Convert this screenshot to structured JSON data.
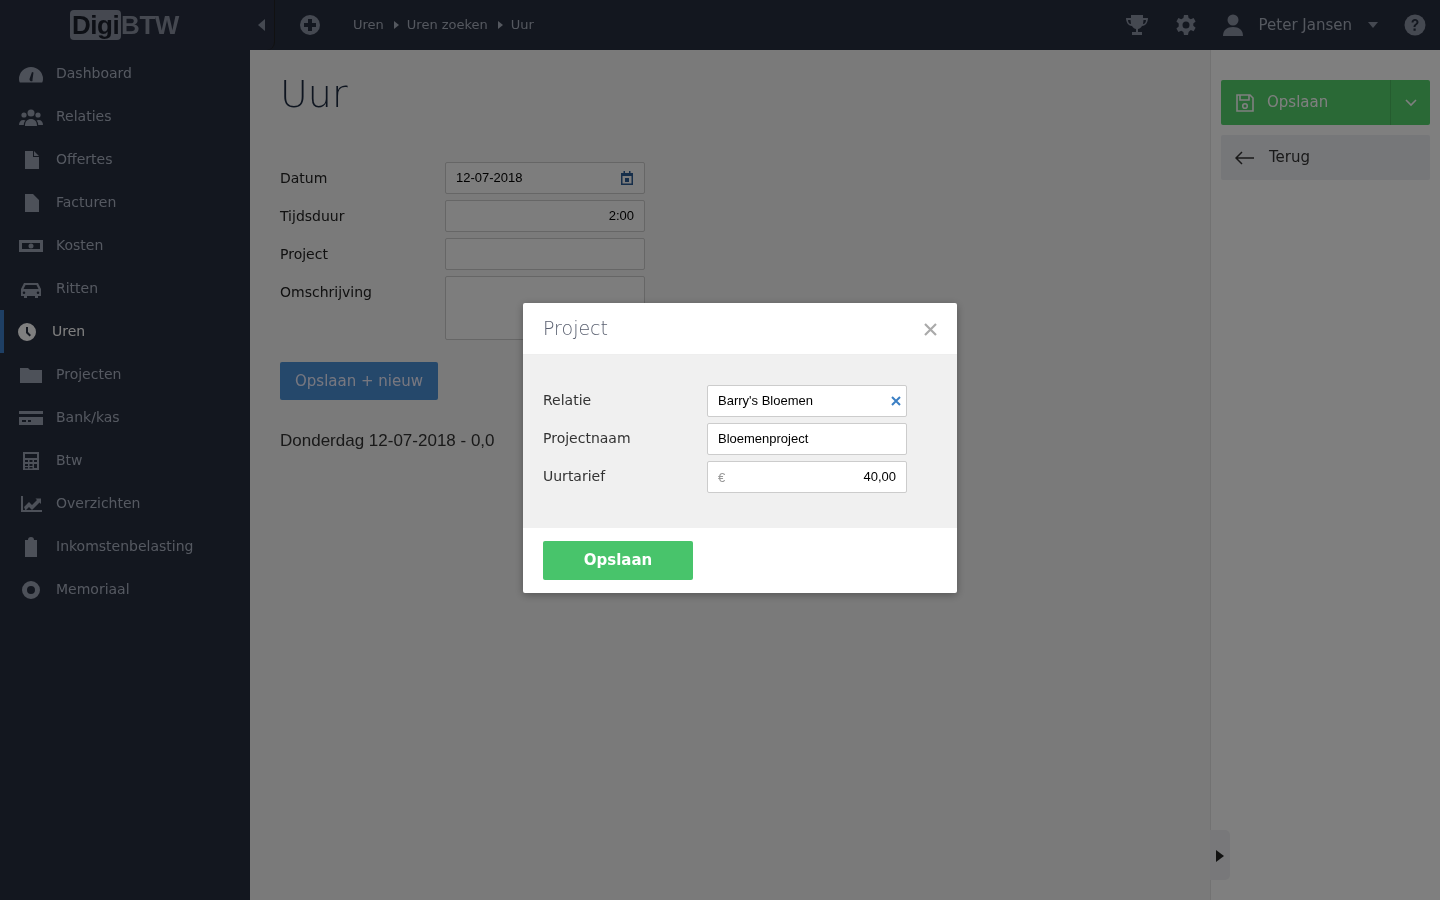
{
  "logo": {
    "boxed": "Digi",
    "plain": "BTW"
  },
  "breadcrumbs": [
    "Uren",
    "Uren zoeken",
    "Uur"
  ],
  "user": {
    "name": "Peter Jansen"
  },
  "sidebar": {
    "items": [
      {
        "label": "Dashboard",
        "selected": false
      },
      {
        "label": "Relaties",
        "selected": false
      },
      {
        "label": "Offertes",
        "selected": false
      },
      {
        "label": "Facturen",
        "selected": false
      },
      {
        "label": "Kosten",
        "selected": false
      },
      {
        "label": "Ritten",
        "selected": false
      },
      {
        "label": "Uren",
        "selected": true
      },
      {
        "label": "Projecten",
        "selected": false
      },
      {
        "label": "Bank/kas",
        "selected": false
      },
      {
        "label": "Btw",
        "selected": false
      },
      {
        "label": "Overzichten",
        "selected": false
      },
      {
        "label": "Inkomstenbelasting",
        "selected": false
      },
      {
        "label": "Memoriaal",
        "selected": false
      }
    ]
  },
  "page": {
    "title": "Uur",
    "fields": [
      {
        "label": "Datum",
        "kind": "date",
        "value": "12-07-2018"
      },
      {
        "label": "Tijdsduur",
        "kind": "number",
        "value": "2:00"
      },
      {
        "label": "Project",
        "kind": "text"
      },
      {
        "label": "Omschrijving",
        "kind": "textarea"
      }
    ],
    "save_new_button": "Opslaan + nieuw",
    "summary": "Donderdag 12-07-2018 - 0,0"
  },
  "actions": {
    "save": "Opslaan",
    "back": "Terug"
  },
  "modal": {
    "title": "Project",
    "fields": [
      {
        "label": "Relatie",
        "kind": "select",
        "value": "Barry's Bloemen"
      },
      {
        "label": "Projectnaam",
        "kind": "text",
        "value": "Bloemenproject"
      },
      {
        "label": "Uurtarief",
        "kind": "money",
        "prefix": "€",
        "value": "40,00"
      }
    ],
    "save_button": "Opslaan"
  }
}
